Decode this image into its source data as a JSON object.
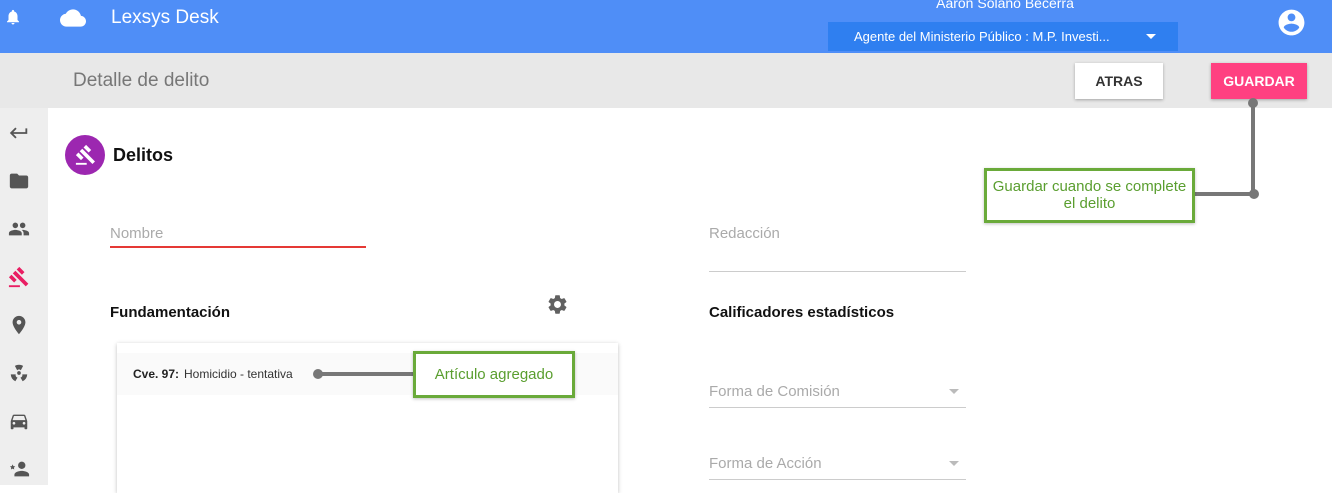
{
  "header": {
    "app_title": "Lexsys Desk",
    "user_name": "Aaron Solano Becerra",
    "role": "Agente del Ministerio Público : M.P. Investi...",
    "icons": [
      "bell-icon",
      "cloud-icon",
      "account-circle-icon"
    ],
    "accent_color": "#4f8ef7"
  },
  "subheader": {
    "title": "Detalle de delito",
    "back_label": "ATRAS",
    "save_label": "GUARDAR"
  },
  "sidebar": {
    "icons": [
      "back-arrow-icon",
      "folder-icon",
      "people-icon",
      "gavel-icon",
      "location-pin-icon",
      "hazard-icon",
      "car-icon",
      "person-star-icon"
    ],
    "active_index": 3
  },
  "main": {
    "section_title": "Delitos",
    "nombre_placeholder": "Nombre",
    "redaccion_placeholder": "Redacción",
    "fundamentacion_title": "Fundamentación",
    "articles": [
      {
        "code": "Cve. 97:",
        "description": "Homicidio - tentativa"
      }
    ],
    "calificadores_title": "Calificadores estadísticos",
    "forma_comision_label": "Forma de Comisión",
    "forma_accion_label": "Forma de Acción"
  },
  "annotations": {
    "save_tip": "Guardar cuando se complete el delito",
    "article_tip": "Artículo agregado"
  }
}
